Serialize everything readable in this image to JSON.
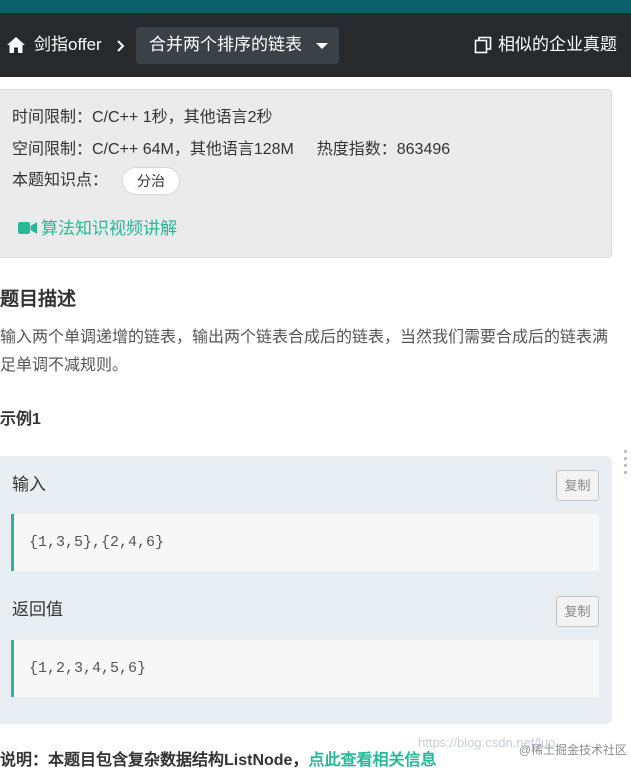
{
  "nav": {
    "breadcrumb": "剑指offer",
    "problem_title": "合并两个排序的链表",
    "similar_label": "相似的企业真题"
  },
  "limits": {
    "time_limit": "时间限制：C/C++ 1秒，其他语言2秒",
    "space_limit": "空间限制：C/C++ 64M，其他语言128M",
    "hotness": "热度指数：863496",
    "knowledge_label": "本题知识点：",
    "tag": "分治",
    "video_link": "算法知识视频讲解"
  },
  "description": {
    "heading": "题目描述",
    "text": "输入两个单调递增的链表，输出两个链表合成后的链表，当然我们需要合成后的链表满足单调不减规则。"
  },
  "example": {
    "heading": "示例1",
    "input_label": "输入",
    "input_value": "{1,3,5},{2,4,6}",
    "output_label": "返回值",
    "output_value": "{1,2,3,4,5,6}",
    "copy_label": "复制"
  },
  "note": {
    "text": "说明：本题目包含复杂数据结构ListNode，",
    "link": "点此查看相关信息"
  },
  "watermark": {
    "url": "https://blog.csdn.net/luo...",
    "site": "@稀土掘金技术社区"
  },
  "colors": {
    "accent": "#26b897",
    "navbar": "#262a2d",
    "top_strip": "#0c5f6c"
  }
}
